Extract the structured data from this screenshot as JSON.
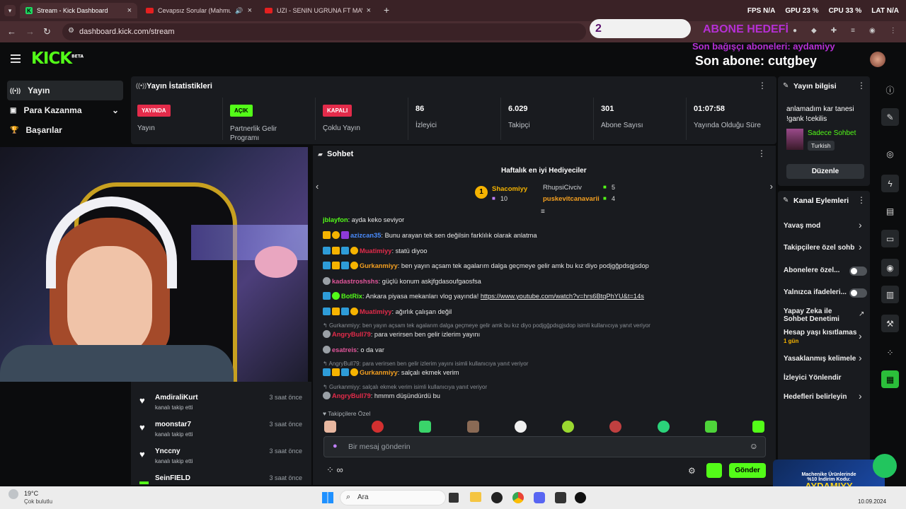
{
  "browser": {
    "tabs": [
      {
        "title": "Stream - Kick Dashboard"
      },
      {
        "title": "Cevapsız Sorular (Mahmut Or"
      },
      {
        "title": "UZI - SENIN UGRUNA FT MAVI - Y"
      }
    ],
    "new_tab": "+",
    "url": "dashboard.kick.com/stream",
    "hud": {
      "fps_label": "FPS",
      "fps": "N/A",
      "gpu_label": "GPU",
      "gpu": "23 %",
      "cpu_label": "CPU",
      "cpu": "33 %",
      "lat_label": "LAT",
      "lat": "N/A"
    }
  },
  "overlay": {
    "goal_count": "2",
    "goal_label": "ABONE HEDEFİ",
    "donor_line": "Son bağışçı aboneleri: aydamiyy",
    "sub_line": "Son abone: cutgbey",
    "promo_line1": "Machenike Ürünlerinde",
    "promo_line2": "%10 İndirim Kodu:",
    "promo_code": "AYDAMIYY"
  },
  "header": {
    "logo": "KICK",
    "logo_sup": "BETA"
  },
  "sidebar": {
    "items": [
      {
        "label": "Yayın"
      },
      {
        "label": "Para Kazanma"
      },
      {
        "label": "Başarılar"
      }
    ]
  },
  "stats": {
    "title": "Yayın İstatistikleri",
    "items": [
      {
        "badge": "YAYINDA",
        "label": "Yayın"
      },
      {
        "badge": "AÇIK",
        "label": "Partnerlik Gelir Programı"
      },
      {
        "badge": "KAPALI",
        "label": "Çoklu Yayın"
      },
      {
        "value": "86",
        "label": "İzleyici"
      },
      {
        "value": "6.029",
        "label": "Takipçi"
      },
      {
        "value": "301",
        "label": "Abone Sayısı"
      },
      {
        "value": "01:07:58",
        "label": "Yayında Olduğu Süre"
      }
    ]
  },
  "followers": [
    {
      "name": "AmdiraliKurt",
      "sub": "kanalı takip etti",
      "time": "3 saat önce"
    },
    {
      "name": "moonstar7",
      "sub": "kanalı takip etti",
      "time": "3 saat önce"
    },
    {
      "name": "Ynccny",
      "sub": "kanalı takip etti",
      "time": "3 saat önce"
    },
    {
      "name": "SeinFIELD",
      "sub": "",
      "time": "3 saat önce"
    }
  ],
  "chat": {
    "title": "Sohbet",
    "gifters_title": "Haftalık en iyi Hediyeciler",
    "gifters": [
      {
        "rank": "1",
        "name": "Shacomiyy",
        "count": "10"
      },
      {
        "name": "RhupsiCivciv",
        "count": "5"
      },
      {
        "name": "puskevitcanavarii",
        "count": "4"
      }
    ],
    "messages": [
      {
        "user": "jblayfon",
        "text": ": ayda keko seviyor"
      },
      {
        "user": "azizcan35",
        "text": ": Bunu arayan tek sen değilsin farklılık olarak anlatma"
      },
      {
        "user": "Muatimiyy",
        "text": ": statü diyoo"
      },
      {
        "user": "Gurkanmiyy",
        "text": ": ben yayın açsam tek agalarım dalga geçmeye gelir amk bu kız diyo podjgğpdsgjsdop"
      },
      {
        "user": "kadastroshshs",
        "text": ": güçlü konum askjfgdasoufgaosfsa"
      },
      {
        "user": "BotRix",
        "text": ": Ankara piyasa mekanları vlog yayında! ",
        "link": "https://www.youtube.com/watch?v=hrs6BtqPhYU&t=14s"
      },
      {
        "user": "Muatimiyy",
        "text": ": ağırlık çalışan değil"
      },
      {
        "reply": "Gurkanmiyy: ben yayın açsam tek agalarım dalga geçmeye gelir amk bu kız diyo podjgğpdsgjsdop isimli kullanıcıya yanıt veriyor",
        "user": "AngryBull79",
        "text": ": para verirsen ben gelir izlerim yayını"
      },
      {
        "user": "esatreis",
        "text": ": o da var"
      },
      {
        "reply": "AngryBull79: para verirsen ben gelir izlerim yayını isimli kullanıcıya yanıt veriyor",
        "user": "Gurkanmiyy",
        "text": ": salçalı ekmek verim"
      },
      {
        "reply": "Gurkanmiyy: salçalı ekmek verim isimli kullanıcıya yanıt veriyor",
        "user": "AngryBull79",
        "text": ": hmmm düşündürdü bu"
      }
    ],
    "emote_section": "Takipçilere Özel",
    "input_placeholder": "Bir mesaj gönderin",
    "send_label": "Gönder",
    "infinity": "∞"
  },
  "stream_info": {
    "title": "Yayın bilgisi",
    "stream_title": "anlamadım kar tanesi !gank !cekilis",
    "category": "Sadece Sohbet",
    "language": "Turkish",
    "edit_label": "Düzenle"
  },
  "channel_actions": {
    "title": "Kanal Eylemleri",
    "items": [
      {
        "label": "Yavaş mod"
      },
      {
        "label": "Takipçilere özel sohb"
      },
      {
        "label": "Abonelere özel..."
      },
      {
        "label": "Yalnızca ifadeleri..."
      },
      {
        "label": "Yapay Zeka ile Sohbet Denetimi"
      },
      {
        "label": "Hesap yaşı kısıtlaması",
        "sub": "1 gün"
      },
      {
        "label": "Yasaklanmış kelimele"
      },
      {
        "label": "İzleyici Yönlendir"
      },
      {
        "label": "Hedefleri belirleyin"
      }
    ]
  },
  "taskbar": {
    "weather_temp": "19°C",
    "weather_desc": "Çok bulutlu",
    "search_label": "Ara",
    "date": "10.09.2024"
  },
  "colors": {
    "accent": "#53fc18",
    "live_red": "#e32b4a",
    "chat_bg": "#191b1f",
    "overlay_purple": "#b52fd4"
  }
}
